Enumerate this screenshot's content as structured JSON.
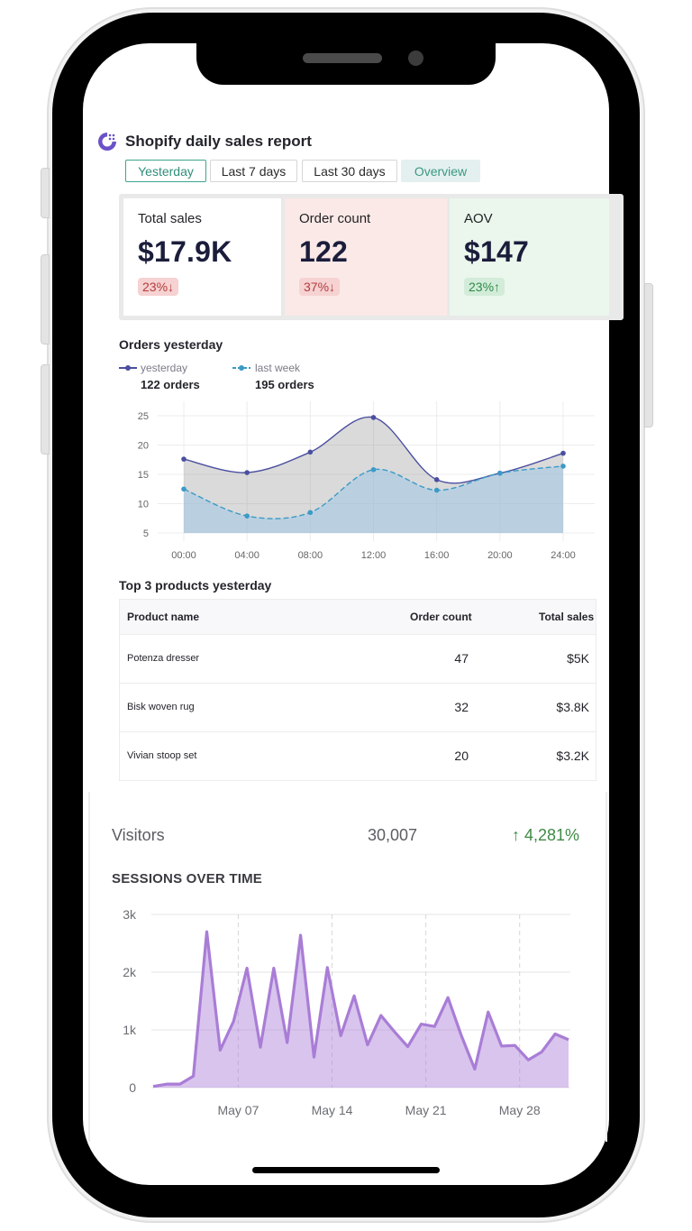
{
  "app": {
    "title": "Shopify daily sales report"
  },
  "tabs": [
    {
      "label": "Yesterday",
      "active": true
    },
    {
      "label": "Last 7 days",
      "active": false
    },
    {
      "label": "Last 30 days",
      "active": false
    },
    {
      "label": "Overview",
      "active": false
    }
  ],
  "kpis": [
    {
      "label": "Total sales",
      "value": "$17.9K",
      "change": "23%↓",
      "direction": "down",
      "bg": "#ffffff"
    },
    {
      "label": "Order count",
      "value": "122",
      "change": "37%↓",
      "direction": "down",
      "bg": "#fbe9e7"
    },
    {
      "label": "AOV",
      "value": "$147",
      "change": "23%↑",
      "direction": "up",
      "bg": "#ebf6ec"
    }
  ],
  "orders_chart": {
    "title": "Orders yesterday",
    "legend": [
      {
        "name": "yesterday",
        "count": "122 orders",
        "color": "#4b4fa0"
      },
      {
        "name": "last week",
        "count": "195 orders",
        "color": "#3b9ac7"
      }
    ]
  },
  "top_products": {
    "title": "Top 3 products yesterday",
    "columns": [
      "Product name",
      "Order count",
      "Total sales"
    ],
    "rows": [
      [
        "Potenza dresser",
        "47",
        "$5K"
      ],
      [
        "Bisk woven rug",
        "32",
        "$3.8K"
      ],
      [
        "Vivian stoop set",
        "20",
        "$3.2K"
      ]
    ]
  },
  "visitors": {
    "label": "Visitors",
    "value": "30,007",
    "change": "↑ 4,281%"
  },
  "sessions": {
    "title": "SESSIONS OVER TIME"
  },
  "chart_data": [
    {
      "type": "area",
      "title": "Orders yesterday",
      "x": [
        "00:00",
        "04:00",
        "08:00",
        "12:00",
        "16:00",
        "20:00",
        "24:00"
      ],
      "series": [
        {
          "name": "yesterday",
          "values": [
            17.6,
            15.3,
            18.8,
            24.7,
            14.1,
            15.2,
            18.6
          ],
          "color": "#4b4fa0"
        },
        {
          "name": "last week",
          "values": [
            12.5,
            7.9,
            8.5,
            15.8,
            12.3,
            15.2,
            16.4
          ],
          "color": "#3b9ac7"
        }
      ],
      "yticks": [
        5,
        10,
        15,
        20,
        25
      ],
      "ylim": [
        5,
        25
      ],
      "grid": true,
      "legend": "top-left"
    },
    {
      "type": "area",
      "title": "SESSIONS OVER TIME",
      "xticks": [
        "May 07",
        "May 14",
        "May 21",
        "May 28"
      ],
      "yticks": [
        "0",
        "1k",
        "2k",
        "3k"
      ],
      "ylim": [
        0,
        3000
      ],
      "xlim": [
        0,
        32
      ],
      "x": [
        0,
        1,
        2,
        3,
        4,
        5,
        6,
        7,
        8,
        9,
        10,
        11,
        12,
        13,
        14,
        15,
        16,
        17,
        18,
        19,
        20,
        21,
        22,
        23,
        24,
        25,
        26,
        27,
        28,
        29,
        30,
        31
      ],
      "series": [
        {
          "name": "",
          "values": [
            20,
            60,
            60,
            200,
            2700,
            650,
            1150,
            2070,
            700,
            2070,
            780,
            2640,
            530,
            2080,
            900,
            1590,
            740,
            1250,
            970,
            710,
            1100,
            1060,
            1560,
            900,
            320,
            1310,
            720,
            730,
            480,
            620,
            930,
            830
          ],
          "color": "#a97dd6"
        }
      ],
      "major_tick_indices": [
        6,
        13,
        20,
        27
      ],
      "grid": true
    }
  ]
}
